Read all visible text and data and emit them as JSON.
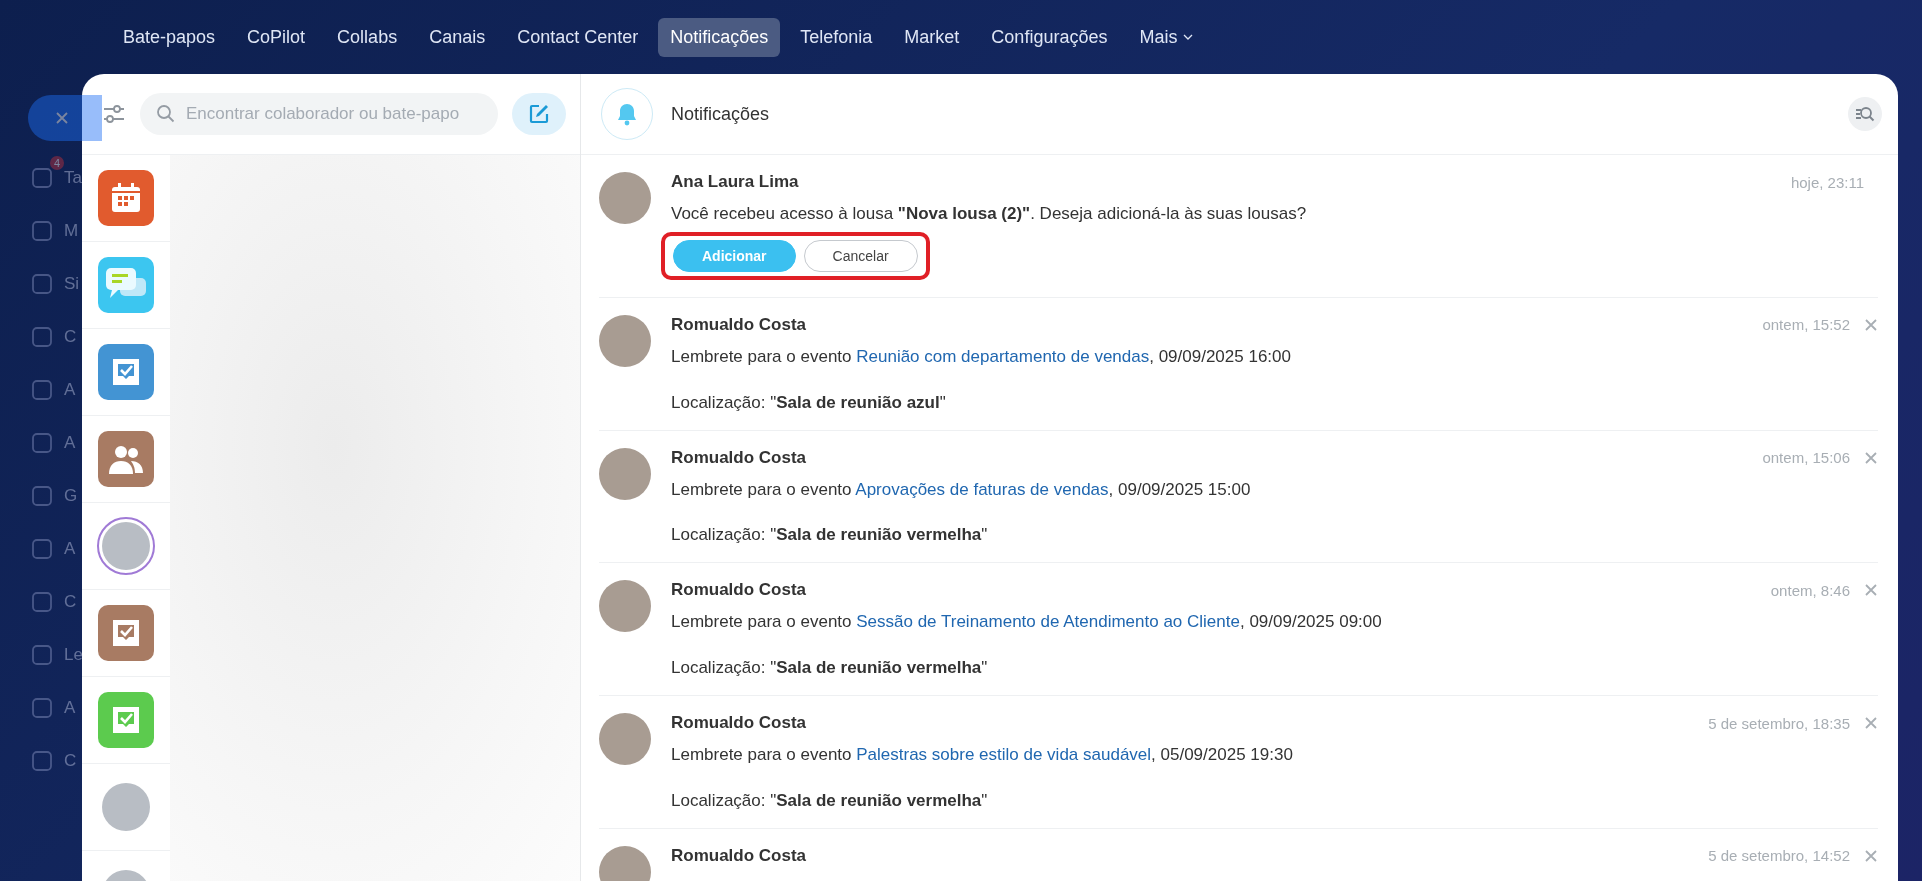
{
  "nav": [
    {
      "label": "Bate-papos",
      "selected": false
    },
    {
      "label": "CoPilot",
      "selected": false
    },
    {
      "label": "Collabs",
      "selected": false
    },
    {
      "label": "Canais",
      "selected": false
    },
    {
      "label": "Contact Center",
      "selected": false
    },
    {
      "label": "Notificações",
      "selected": true
    },
    {
      "label": "Telefonia",
      "selected": false
    },
    {
      "label": "Market",
      "selected": false
    },
    {
      "label": "Configurações",
      "selected": false
    },
    {
      "label": "Mais",
      "selected": false,
      "dropdown": true
    }
  ],
  "back_sidebar": {
    "items": [
      {
        "label": "Ta",
        "badge": "4"
      },
      {
        "label": "M"
      },
      {
        "label": "Si"
      },
      {
        "label": "C"
      },
      {
        "label": "A"
      },
      {
        "label": "A"
      },
      {
        "label": "G"
      },
      {
        "label": "A"
      },
      {
        "label": "C"
      },
      {
        "label": "Le"
      },
      {
        "label": "A"
      },
      {
        "label": "C"
      }
    ]
  },
  "search": {
    "placeholder": "Encontrar colaborador ou bate-papo"
  },
  "chats": [
    {
      "kind": "calendar",
      "color": "#e15b2e"
    },
    {
      "kind": "chat",
      "color": "#3cc6f0"
    },
    {
      "kind": "task",
      "color": "#4394d3"
    },
    {
      "kind": "group",
      "color": "#a87b63"
    },
    {
      "kind": "avatar",
      "color": "#a07ad6"
    },
    {
      "kind": "task",
      "color": "#a87b63"
    },
    {
      "kind": "task",
      "color": "#5ccb4e"
    },
    {
      "kind": "avatar",
      "color": "#ffffff"
    },
    {
      "kind": "avatar",
      "color": "#ffffff"
    }
  ],
  "panel": {
    "title": "Notificações"
  },
  "notifications": [
    {
      "kind": "invite",
      "author": "Ana Laura Lima",
      "time": "hoje, 23:11",
      "closable": false,
      "text": "Você recebeu acesso à lousa **\"Nova lousa (2)\"**. Deseja adicioná-la às suas lousas?",
      "highlighted": true,
      "buttons": [
        {
          "label": "Adicionar",
          "primary": true
        },
        {
          "label": "Cancelar",
          "primary": false
        }
      ]
    },
    {
      "kind": "reminder",
      "author": "Romualdo Costa",
      "time": "ontem, 15:52",
      "closable": true,
      "prefix": "Lembrete para o evento ",
      "link": "Reunião com departamento de vendas",
      "suffix": ", 09/09/2025 16:00",
      "location": "Localização: \"**Sala de reunião azul**\""
    },
    {
      "kind": "reminder",
      "author": "Romualdo Costa",
      "time": "ontem, 15:06",
      "closable": true,
      "prefix": "Lembrete para o evento ",
      "link": "Aprovações de faturas de vendas",
      "suffix": ", 09/09/2025 15:00",
      "location": "Localização: \"**Sala de reunião vermelha**\""
    },
    {
      "kind": "reminder",
      "author": "Romualdo Costa",
      "time": "ontem, 8:46",
      "closable": true,
      "prefix": "Lembrete para o evento ",
      "link": "Sessão de Treinamento de Atendimento ao Cliente",
      "suffix": ", 09/09/2025 09:00",
      "location": "Localização: \"**Sala de reunião vermelha**\""
    },
    {
      "kind": "reminder",
      "author": "Romualdo Costa",
      "time": "5 de setembro, 18:35",
      "closable": true,
      "prefix": "Lembrete para o evento ",
      "link": "Palestras sobre estilo de vida saudável",
      "suffix": ", 05/09/2025 19:30",
      "location": "Localização: \"**Sala de reunião vermelha**\""
    },
    {
      "kind": "cut",
      "author": "Romualdo Costa",
      "time": "5 de setembro, 14:52",
      "closable": true
    }
  ]
}
